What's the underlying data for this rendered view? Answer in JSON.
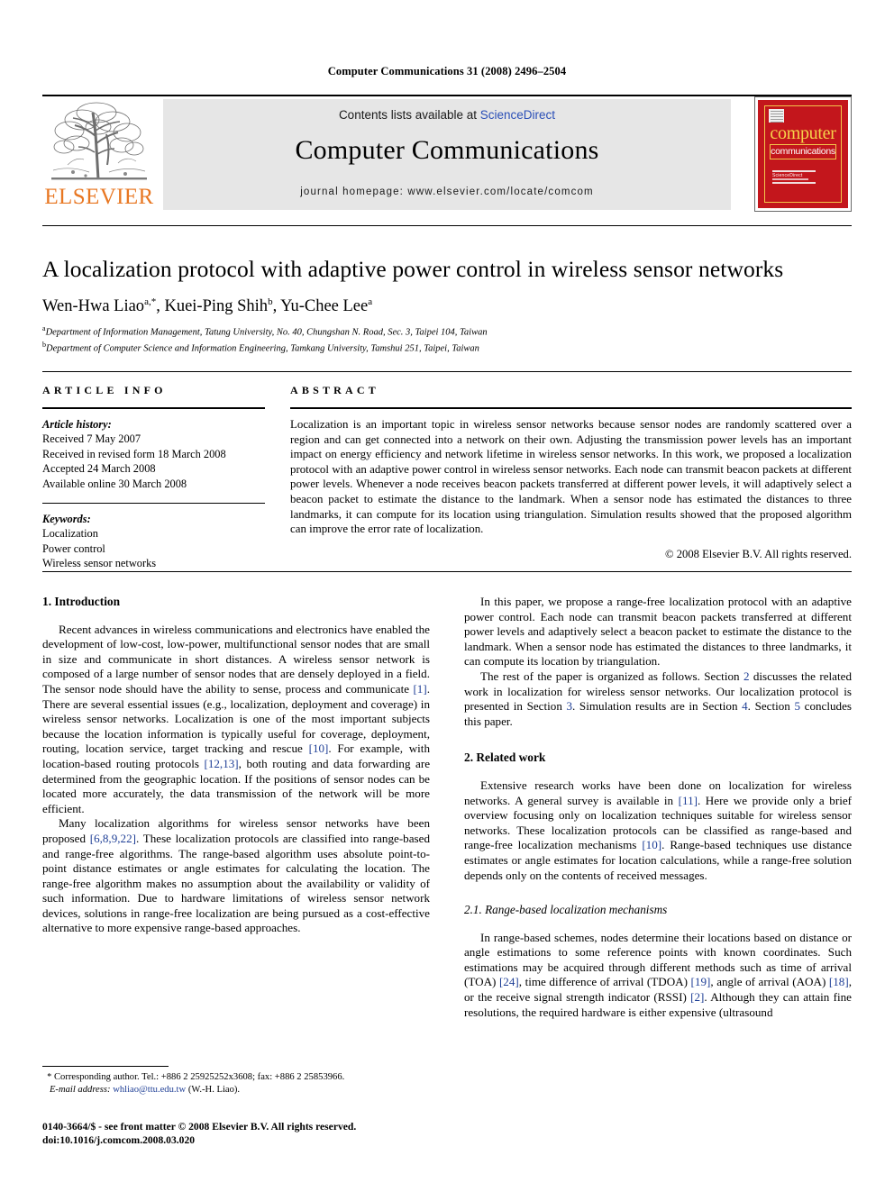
{
  "running_head": "Computer Communications 31 (2008) 2496–2504",
  "masthead": {
    "contents_prefix": "Contents lists available at ",
    "sciencedirect": "ScienceDirect",
    "journal_title": "Computer Communications",
    "homepage": "journal homepage: www.elsevier.com/locate/comcom",
    "publisher_wordmark": "ELSEVIER",
    "cover": {
      "line1": "computer",
      "line2": "communications",
      "sd_word": "ScienceDirect"
    },
    "accent_orange": "#E87722",
    "link_blue": "#2a4fb7",
    "cover_red": "#C3161C",
    "cover_yellow": "#F6D34A",
    "band_grey": "#e6e6e6"
  },
  "title": "A localization protocol with adaptive power control in wireless sensor networks",
  "authors": [
    {
      "name": "Wen-Hwa Liao",
      "marks": "a,*"
    },
    {
      "name": "Kuei-Ping Shih",
      "marks": "b"
    },
    {
      "name": "Yu-Chee Lee",
      "marks": "a"
    }
  ],
  "affiliations": [
    {
      "mark": "a",
      "text": "Department of Information Management, Tatung University, No. 40, Chungshan N. Road, Sec. 3, Taipei 104, Taiwan"
    },
    {
      "mark": "b",
      "text": "Department of Computer Science and Information Engineering, Tamkang University, Tamshui 251, Taipei, Taiwan"
    }
  ],
  "article_info": {
    "heading": "ARTICLE INFO",
    "history_label": "Article history:",
    "history": [
      "Received 7 May 2007",
      "Received in revised form 18 March 2008",
      "Accepted 24 March 2008",
      "Available online 30 March 2008"
    ],
    "keywords_label": "Keywords:",
    "keywords": [
      "Localization",
      "Power control",
      "Wireless sensor networks"
    ]
  },
  "abstract": {
    "heading": "ABSTRACT",
    "text": "Localization is an important topic in wireless sensor networks because sensor nodes are randomly scattered over a region and can get connected into a network on their own. Adjusting the transmission power levels has an important impact on energy efficiency and network lifetime in wireless sensor networks. In this work, we proposed a localization protocol with an adaptive power control in wireless sensor networks. Each node can transmit beacon packets at different power levels. Whenever a node receives beacon packets transferred at different power levels, it will adaptively select a beacon packet to estimate the distance to the landmark. When a sensor node has estimated the distances to three landmarks, it can compute for its location using triangulation. Simulation results showed that the proposed algorithm can improve the error rate of localization.",
    "copyright": "© 2008 Elsevier B.V. All rights reserved."
  },
  "sections": {
    "intro_heading": "1. Introduction",
    "intro_p1_a": "Recent advances in wireless communications and electronics have enabled the development of low-cost, low-power, multifunctional sensor nodes that are small in size and communicate in short distances. A wireless sensor network is composed of a large number of sensor nodes that are densely deployed in a field. The sensor node should have the ability to sense, process and communicate ",
    "intro_p1_ref1": "[1]",
    "intro_p1_b": ". There are several essential issues (e.g., localization, deployment and coverage) in wireless sensor networks. Localization is one of the most important subjects because the location information is typically useful for coverage, deployment, routing, location service, target tracking and rescue ",
    "intro_p1_ref2": "[10]",
    "intro_p1_c": ". For example, with location-based routing protocols ",
    "intro_p1_ref3": "[12,13]",
    "intro_p1_d": ", both routing and data forwarding are determined from the geographic location. If the positions of sensor nodes can be located more accurately, the data transmission of the network will be more efficient.",
    "intro_p2_a": "Many localization algorithms for wireless sensor networks have been proposed ",
    "intro_p2_ref1": "[6,8,9,22]",
    "intro_p2_b": ". These localization protocols are classified into range-based and range-free algorithms. The range-based algorithm uses absolute point-to-point distance estimates or angle estimates for calculating the location. The range-free algorithm makes no assumption about the availability or validity of such information. Due to hardware limitations of wireless sensor network devices, solutions in range-free localization are being pursued as a cost-effective alternative to more expensive range-based approaches.",
    "right_p1": "In this paper, we propose a range-free localization protocol with an adaptive power control. Each node can transmit beacon packets transferred at different power levels and adaptively select a beacon packet to estimate the distance to the landmark. When a sensor node has estimated the distances to three landmarks, it can compute its location by triangulation.",
    "right_p2_a": "The rest of the paper is organized as follows. Section ",
    "right_p2_ref1": "2",
    "right_p2_b": " discusses the related work in localization for wireless sensor networks. Our localization protocol is presented in Section ",
    "right_p2_ref2": "3",
    "right_p2_c": ". Simulation results are in Section ",
    "right_p2_ref3": "4",
    "right_p2_d": ". Section ",
    "right_p2_ref4": "5",
    "right_p2_e": " concludes this paper.",
    "related_heading": "2. Related work",
    "related_p1_a": "Extensive research works have been done on localization for wireless networks. A general survey is available in ",
    "related_p1_ref1": "[11]",
    "related_p1_b": ". Here we provide only a brief overview focusing only on localization techniques suitable for wireless sensor networks. These localization protocols can be classified as range-based and range-free localization mechanisms ",
    "related_p1_ref2": "[10]",
    "related_p1_c": ". Range-based techniques use distance estimates or angle estimates for location calculations, while a range-free solution depends only on the contents of received messages.",
    "sub21_heading": "2.1. Range-based localization mechanisms",
    "sub21_p1_a": "In range-based schemes, nodes determine their locations based on distance or angle estimations to some reference points with known coordinates. Such estimations may be acquired through different methods such as time of arrival (TOA) ",
    "sub21_ref1": "[24]",
    "sub21_p1_b": ", time difference of arrival (TDOA) ",
    "sub21_ref2": "[19]",
    "sub21_p1_c": ", angle of arrival (AOA) ",
    "sub21_ref3": "[18]",
    "sub21_p1_d": ", or the receive signal strength indicator (RSSI) ",
    "sub21_ref4": "[2]",
    "sub21_p1_e": ". Although they can attain fine resolutions, the required hardware is either expensive (ultrasound"
  },
  "footnote": {
    "star": "*",
    "corresponding": "Corresponding author. Tel.: +886 2 25925252x3608; fax: +886 2 25853966.",
    "email_label": "E-mail address:",
    "email": "whliao@ttu.edu.tw",
    "email_suffix": "(W.-H. Liao)."
  },
  "imprint": {
    "line1": "0140-3664/$ - see front matter © 2008 Elsevier B.V. All rights reserved.",
    "line2": "doi:10.1016/j.comcom.2008.03.020"
  }
}
